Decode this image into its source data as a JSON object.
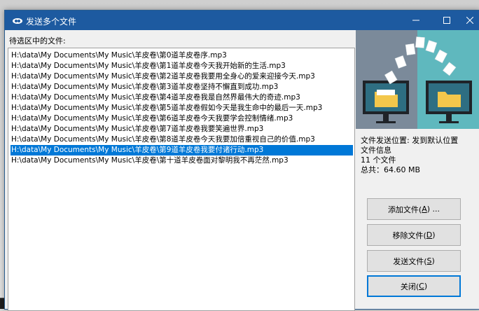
{
  "window": {
    "title": "发送多个文件"
  },
  "list": {
    "label": "待选区中的文件:",
    "items": [
      "H:\\data\\My Documents\\My Music\\羊皮卷\\第0道羊皮卷序.mp3",
      "H:\\data\\My Documents\\My Music\\羊皮卷\\第1道羊皮卷今天我开始新的生活.mp3",
      "H:\\data\\My Documents\\My Music\\羊皮卷\\第2道羊皮卷我要用全身心的爱来迎接今天.mp3",
      "H:\\data\\My Documents\\My Music\\羊皮卷\\第3道羊皮卷坚持不懈直到成功.mp3",
      "H:\\data\\My Documents\\My Music\\羊皮卷\\第4道羊皮卷我是自然界最伟大的奇迹.mp3",
      "H:\\data\\My Documents\\My Music\\羊皮卷\\第5道羊皮卷假如今天是我生命中的最后一天.mp3",
      "H:\\data\\My Documents\\My Music\\羊皮卷\\第6道羊皮卷今天我要学会控制情绪.mp3",
      "H:\\data\\My Documents\\My Music\\羊皮卷\\第7道羊皮卷我要笑遍世界.mp3",
      "H:\\data\\My Documents\\My Music\\羊皮卷\\第8道羊皮卷今天我要加倍重视自己的价值.mp3",
      "H:\\data\\My Documents\\My Music\\羊皮卷\\第9道羊皮卷我要付诸行动.mp3",
      "H:\\data\\My Documents\\My Music\\羊皮卷\\第十道羊皮卷面对黎明我不再茫然.mp3"
    ],
    "selected_index": 9
  },
  "info": {
    "location": "文件发送位置: 发到默认位置",
    "file_info": "文件信息",
    "count": "11 个文件",
    "total": "总共：64.60 MB"
  },
  "buttons": {
    "add": {
      "text": "添加文件(",
      "key": "A",
      "after": ") ..."
    },
    "remove": {
      "text": "移除文件(",
      "key": "D",
      "after": ")"
    },
    "send": {
      "text": "发送文件(",
      "key": "S",
      "after": ")"
    },
    "close": {
      "text": "关闭(",
      "key": "C",
      "after": ")"
    }
  },
  "colors": {
    "titlebar": "#1d5aa0",
    "selection": "#0078d7",
    "illustration_bg": "#5fb8be"
  }
}
